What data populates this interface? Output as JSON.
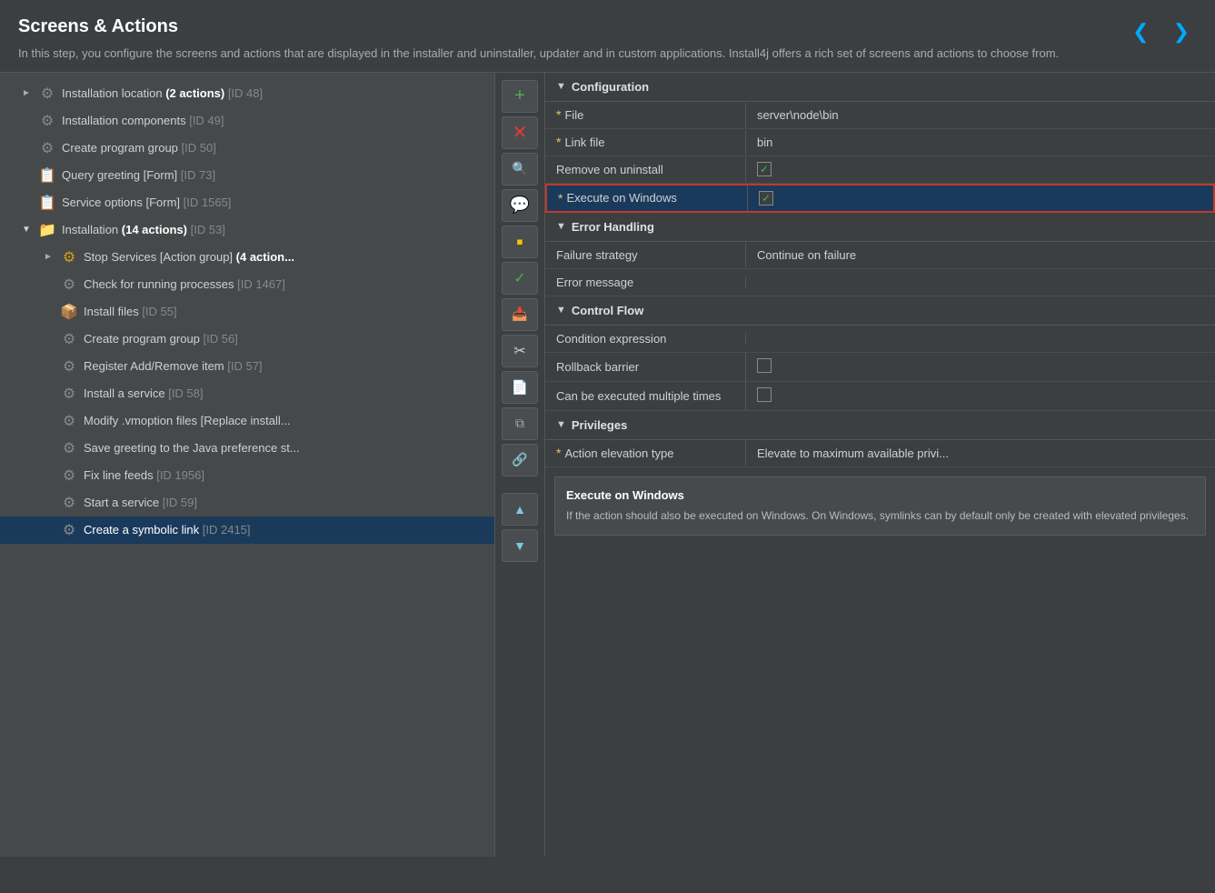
{
  "header": {
    "title": "Screens & Actions",
    "description": "In this step, you configure the screens and actions that are displayed in the installer and uninstaller, updater and in custom applications. Install4j offers a rich set of screens and actions to choose from.",
    "nav_back_label": "❮",
    "nav_forward_label": "❯"
  },
  "tree": {
    "items": [
      {
        "id": "install-location",
        "indent": 1,
        "icon": "gear",
        "label": "Installation location ",
        "bold": "(2 actions)",
        "gray": " [ID 48]",
        "expand": "►",
        "expanded": false
      },
      {
        "id": "install-components",
        "indent": 1,
        "icon": "gear",
        "label": "Installation components",
        "bold": "",
        "gray": " [ID 49]",
        "expand": "",
        "expanded": false
      },
      {
        "id": "create-program-group",
        "indent": 1,
        "icon": "gear",
        "label": "Create program group",
        "bold": "",
        "gray": " [ID 50]",
        "expand": "",
        "expanded": false
      },
      {
        "id": "query-greeting",
        "indent": 1,
        "icon": "form",
        "label": "Query greeting [Form]",
        "bold": "",
        "gray": " [ID 73]",
        "expand": "",
        "expanded": false
      },
      {
        "id": "service-options",
        "indent": 1,
        "icon": "form",
        "label": "Service options [Form]",
        "bold": "",
        "gray": " [ID 1565]",
        "expand": "",
        "expanded": false
      },
      {
        "id": "installation",
        "indent": 1,
        "icon": "folder",
        "label": "Installation ",
        "bold": "(14 actions)",
        "gray": " [ID 53]",
        "expand": "▼",
        "expanded": true
      },
      {
        "id": "stop-services",
        "indent": 2,
        "icon": "folder-gear",
        "label": "Stop Services [Action group] ",
        "bold": "(4 action...",
        "gray": "",
        "expand": "►",
        "expanded": false
      },
      {
        "id": "check-running",
        "indent": 2,
        "icon": "gear",
        "label": "Check for running processes",
        "bold": "",
        "gray": " [ID 1467]",
        "expand": "",
        "expanded": false
      },
      {
        "id": "install-files",
        "indent": 2,
        "icon": "folder-yellow",
        "label": "Install files",
        "bold": "",
        "gray": " [ID 55]",
        "expand": "",
        "expanded": false
      },
      {
        "id": "create-program-group2",
        "indent": 2,
        "icon": "gear",
        "label": "Create program group",
        "bold": "",
        "gray": " [ID 56]",
        "expand": "",
        "expanded": false
      },
      {
        "id": "register-add-remove",
        "indent": 2,
        "icon": "gear",
        "label": "Register Add/Remove item",
        "bold": "",
        "gray": " [ID 57]",
        "expand": "",
        "expanded": false
      },
      {
        "id": "install-service",
        "indent": 2,
        "icon": "gear",
        "label": "Install a service",
        "bold": "",
        "gray": " [ID 58]",
        "expand": "",
        "expanded": false
      },
      {
        "id": "modify-vmoption",
        "indent": 2,
        "icon": "gear",
        "label": "Modify .vmoption files [Replace install...",
        "bold": "",
        "gray": "",
        "expand": "",
        "expanded": false
      },
      {
        "id": "save-greeting",
        "indent": 2,
        "icon": "gear",
        "label": "Save greeting to the Java preference st...",
        "bold": "",
        "gray": "",
        "expand": "",
        "expanded": false
      },
      {
        "id": "fix-line-feeds",
        "indent": 2,
        "icon": "gear",
        "label": "Fix line feeds",
        "bold": "",
        "gray": " [ID 1956]",
        "expand": "",
        "expanded": false
      },
      {
        "id": "start-service",
        "indent": 2,
        "icon": "gear",
        "label": "Start a service",
        "bold": "",
        "gray": " [ID 59]",
        "expand": "",
        "expanded": false
      },
      {
        "id": "create-symlink",
        "indent": 2,
        "icon": "gear",
        "label": "Create a symbolic link",
        "bold": "",
        "gray": " [ID 2415]",
        "expand": "",
        "expanded": false,
        "active": true
      }
    ]
  },
  "toolbar": {
    "buttons": [
      {
        "id": "add",
        "icon": "+",
        "color": "green",
        "label": "Add"
      },
      {
        "id": "delete",
        "icon": "✕",
        "color": "red",
        "label": "Delete"
      },
      {
        "id": "search",
        "icon": "🔍",
        "color": "blue",
        "label": "Search"
      },
      {
        "id": "comment",
        "icon": "💬",
        "color": "yellow",
        "label": "Comment"
      },
      {
        "id": "sticky",
        "icon": "▪",
        "color": "yellow",
        "label": "Sticky note"
      },
      {
        "id": "check",
        "icon": "✓",
        "color": "blue",
        "label": "Check"
      },
      {
        "id": "import",
        "icon": "📥",
        "color": "teal",
        "label": "Import"
      },
      {
        "id": "cut",
        "icon": "✂",
        "color": "scissors",
        "label": "Cut"
      },
      {
        "id": "document",
        "icon": "📄",
        "color": "blue",
        "label": "Document"
      },
      {
        "id": "copy",
        "icon": "⧉",
        "color": "blue",
        "label": "Copy"
      },
      {
        "id": "link",
        "icon": "🔗",
        "color": "orange",
        "label": "Link"
      },
      {
        "id": "move-up",
        "icon": "▲",
        "color": "blue",
        "label": "Move Up"
      },
      {
        "id": "move-down",
        "icon": "▼",
        "color": "blue",
        "label": "Move Down"
      }
    ]
  },
  "config": {
    "sections": [
      {
        "id": "configuration",
        "title": "Configuration",
        "rows": [
          {
            "id": "file",
            "label": "File",
            "required": true,
            "value": "server\\node\\bin",
            "type": "text"
          },
          {
            "id": "link-file",
            "label": "Link file",
            "required": true,
            "value": "bin",
            "type": "text"
          },
          {
            "id": "remove-uninstall",
            "label": "Remove on uninstall",
            "required": false,
            "value": "",
            "type": "checkbox",
            "checked": true
          },
          {
            "id": "execute-windows",
            "label": "Execute on Windows",
            "required": true,
            "value": "",
            "type": "checkbox",
            "checked": true,
            "highlighted": true
          }
        ]
      },
      {
        "id": "error-handling",
        "title": "Error Handling",
        "rows": [
          {
            "id": "failure-strategy",
            "label": "Failure strategy",
            "required": false,
            "value": "Continue on failure",
            "type": "text"
          },
          {
            "id": "error-message",
            "label": "Error message",
            "required": false,
            "value": "",
            "type": "text"
          }
        ]
      },
      {
        "id": "control-flow",
        "title": "Control Flow",
        "rows": [
          {
            "id": "condition-expression",
            "label": "Condition expression",
            "required": false,
            "value": "",
            "type": "text"
          },
          {
            "id": "rollback-barrier",
            "label": "Rollback barrier",
            "required": false,
            "value": "",
            "type": "checkbox",
            "checked": false
          },
          {
            "id": "can-execute-multiple",
            "label": "Can be executed multiple times",
            "required": false,
            "value": "",
            "type": "checkbox",
            "checked": false
          }
        ]
      },
      {
        "id": "privileges",
        "title": "Privileges",
        "rows": [
          {
            "id": "action-elevation",
            "label": "Action elevation type",
            "required": true,
            "value": "Elevate to maximum available privi...",
            "type": "text"
          }
        ]
      }
    ],
    "info_box": {
      "title": "Execute on Windows",
      "text": "If the action should also be executed on Windows. On Windows, symlinks can by default only be created with elevated privileges."
    }
  }
}
